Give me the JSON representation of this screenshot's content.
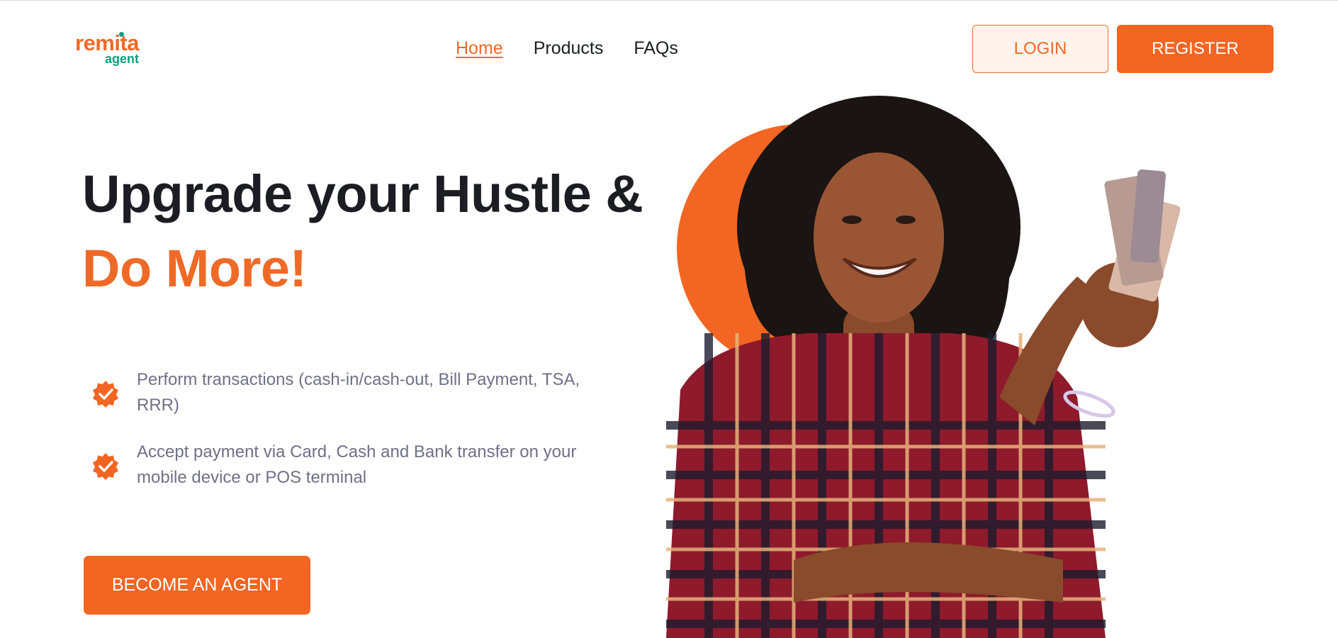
{
  "header": {
    "logo_text": "remita",
    "logo_subtext": "agent",
    "nav": [
      {
        "label": "Home",
        "active": true
      },
      {
        "label": "Products",
        "active": false
      },
      {
        "label": "FAQs",
        "active": false
      }
    ],
    "login_label": "LOGIN",
    "register_label": "REGISTER"
  },
  "hero": {
    "headline_line1": "Upgrade your Hustle &",
    "headline_line2": "Do More!",
    "features": [
      {
        "icon": "verified-badge-icon",
        "text": "Perform transactions (cash-in/cash-out, Bill Payment, TSA, RRR)"
      },
      {
        "icon": "verified-badge-icon",
        "text": "Accept payment via Card, Cash and Bank transfer on your mobile device or POS terminal"
      }
    ],
    "cta_label": "BECOME AN AGENT",
    "image": "smiling-woman-holding-cash-photo"
  },
  "colors": {
    "brand_orange": "#f26522",
    "brand_green": "#0e9f7f",
    "text_dark": "#1b1d22",
    "text_muted": "#6f7088"
  }
}
